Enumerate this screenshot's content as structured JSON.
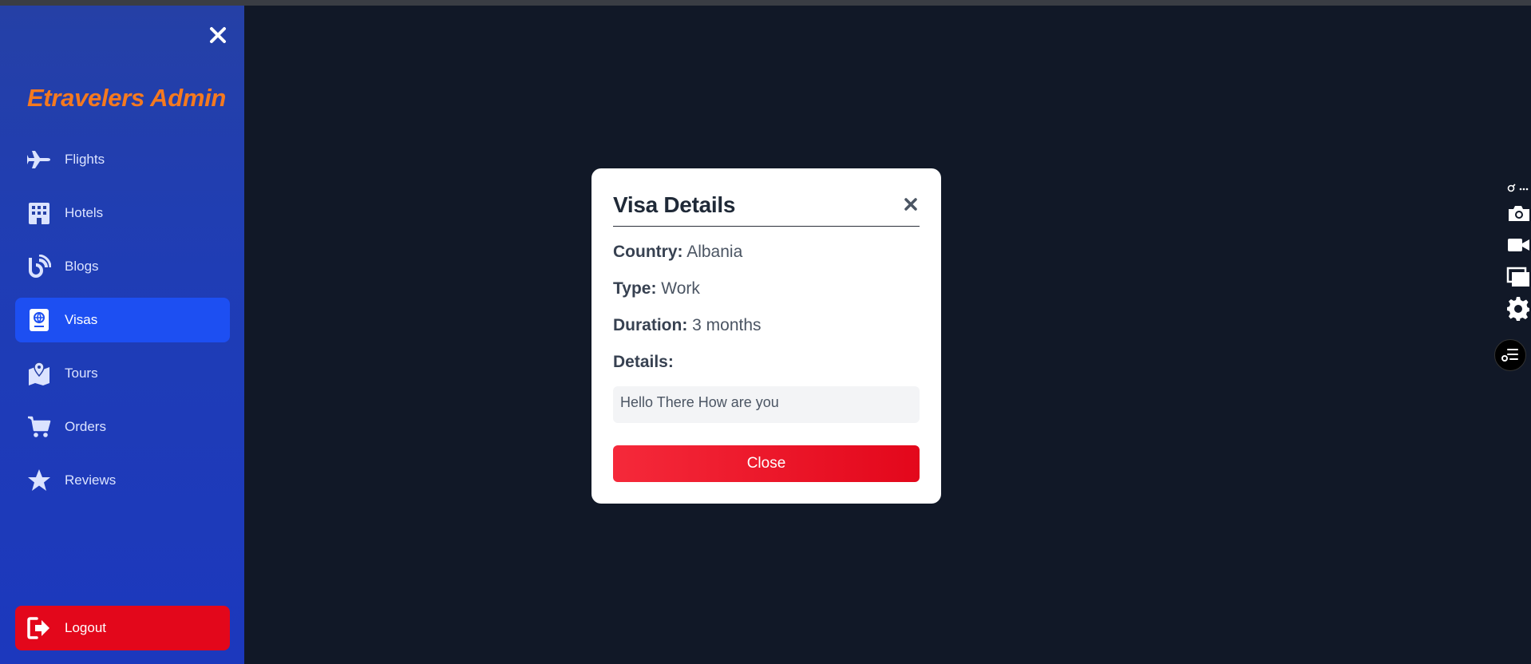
{
  "sidebar": {
    "brand": "Etravelers Admin",
    "items": [
      {
        "label": "Flights",
        "icon": "plane-icon"
      },
      {
        "label": "Hotels",
        "icon": "building-icon"
      },
      {
        "label": "Blogs",
        "icon": "blog-icon"
      },
      {
        "label": "Visas",
        "icon": "passport-icon",
        "active": true
      },
      {
        "label": "Tours",
        "icon": "map-marker-icon"
      },
      {
        "label": "Orders",
        "icon": "cart-icon"
      },
      {
        "label": "Reviews",
        "icon": "star-icon"
      }
    ],
    "logout_label": "Logout"
  },
  "modal": {
    "title": "Visa Details",
    "country_label": "Country:",
    "country_value": "Albania",
    "type_label": "Type:",
    "type_value": "Work",
    "duration_label": "Duration:",
    "duration_value": "3 months",
    "details_label": "Details:",
    "details_value": "Hello There How are you",
    "close_label": "Close"
  },
  "colors": {
    "brand": "#f5791f",
    "sidebar": "#1f3db5",
    "active_item": "#1d4ff2",
    "logout": "#e3071b",
    "background": "#111827"
  }
}
